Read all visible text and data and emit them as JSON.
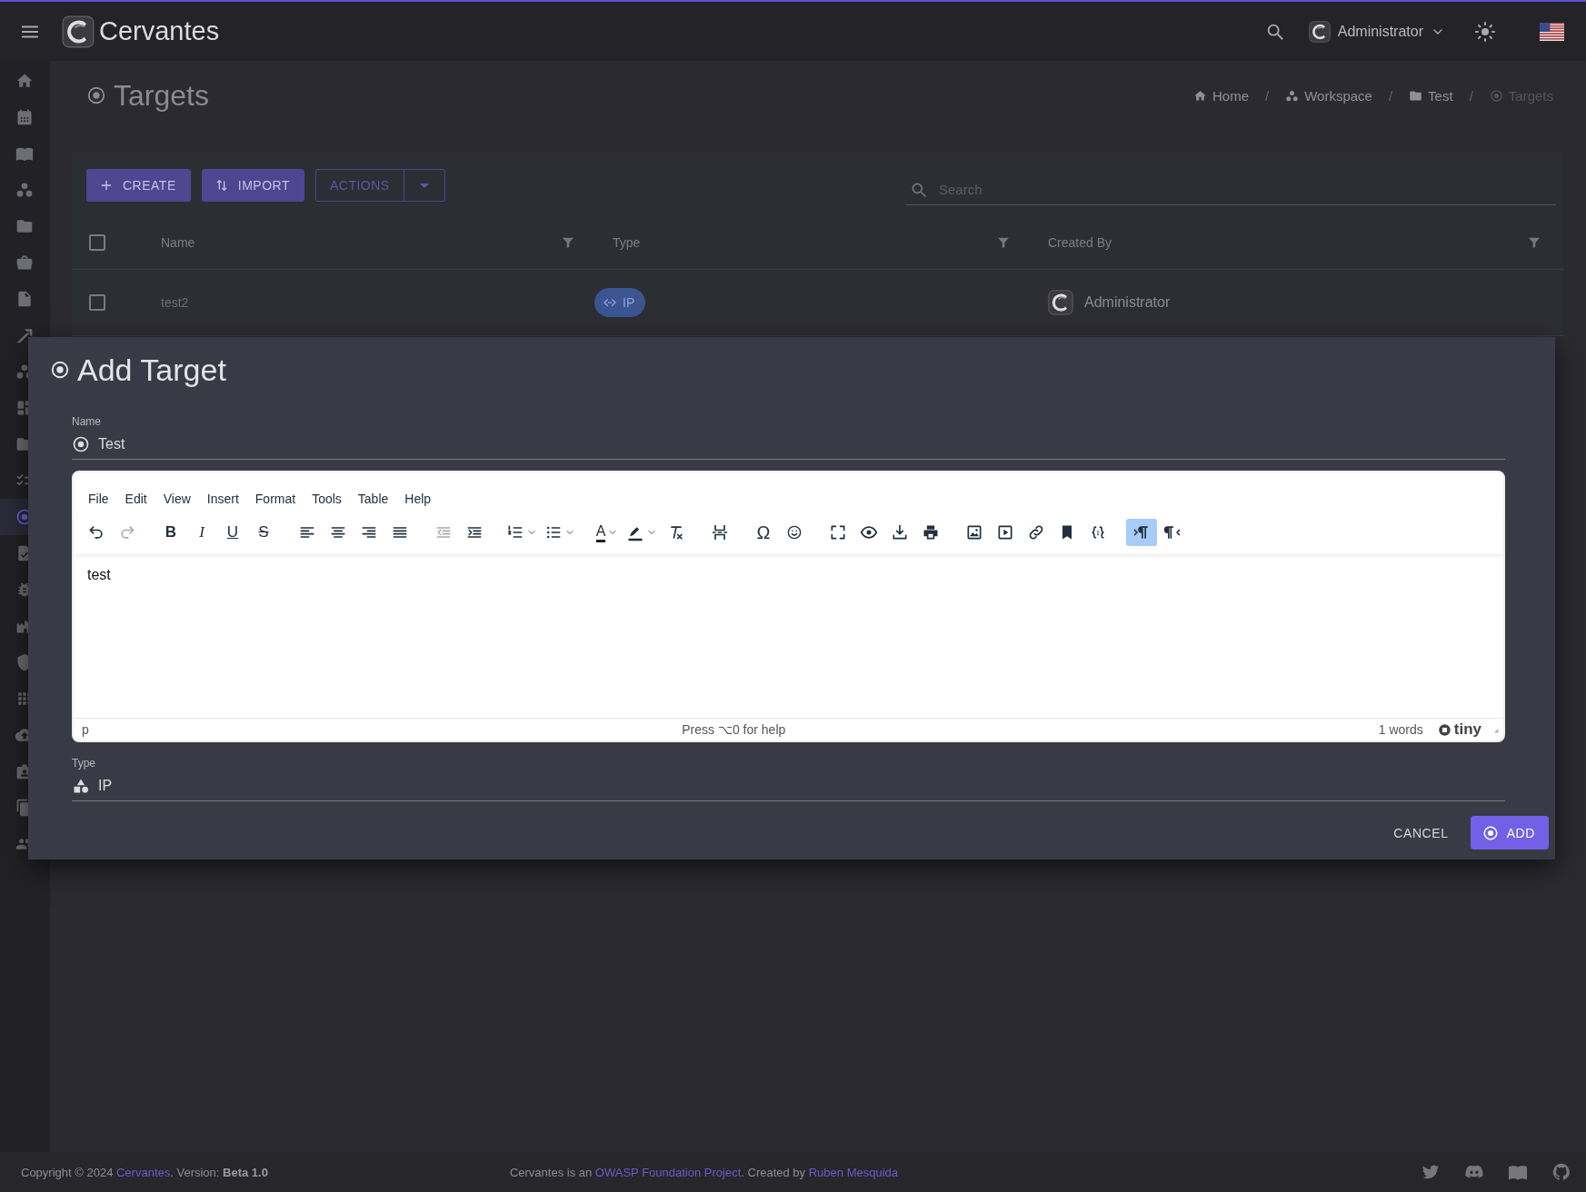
{
  "app": {
    "title": "Cervantes"
  },
  "header": {
    "user": "Administrator"
  },
  "sidebar": {
    "items": [
      {
        "selected": false
      },
      {
        "selected": false
      },
      {
        "selected": false
      },
      {
        "selected": false
      },
      {
        "selected": false
      },
      {
        "selected": false
      },
      {
        "selected": false
      },
      {
        "selected": false
      },
      {
        "selected": false
      },
      {
        "selected": false
      },
      {
        "selected": false
      },
      {
        "selected": false
      },
      {
        "selected": true
      },
      {
        "selected": false
      },
      {
        "selected": false
      },
      {
        "selected": false
      },
      {
        "selected": false
      },
      {
        "selected": false
      },
      {
        "selected": false
      },
      {
        "selected": false
      },
      {
        "selected": false
      },
      {
        "selected": false
      }
    ]
  },
  "page": {
    "title": "Targets",
    "breadcrumbs": [
      {
        "label": "Home",
        "current": false
      },
      {
        "separator": "/",
        "label": "Workspace",
        "current": false
      },
      {
        "separator": "/",
        "label": "Test",
        "current": false
      },
      {
        "separator": "/",
        "label": "Targets",
        "current": true
      }
    ]
  },
  "toolbar": {
    "create": "CREATE",
    "import": "IMPORT",
    "actions": "ACTIONS",
    "search": {
      "placeholder": "Search"
    }
  },
  "table": {
    "header_checked": false,
    "columns": [
      "Name",
      "Type",
      "Created By"
    ],
    "rows": [
      {
        "checked": false,
        "name": "test2",
        "type": "IP",
        "created_by": "Administrator"
      }
    ]
  },
  "dialog": {
    "title": "Add Target",
    "name_field": {
      "label": "Name",
      "value": "Test"
    },
    "editor": {
      "menu": [
        "File",
        "Edit",
        "View",
        "Insert",
        "Format",
        "Tools",
        "Table",
        "Help"
      ],
      "toolbar": [
        [
          {
            "kind": "icon",
            "split": false,
            "active": false,
            "disabled": false
          },
          {
            "kind": "icon",
            "split": false,
            "active": false,
            "disabled": true
          }
        ],
        [
          {
            "kind": "glyph",
            "glyph": "B",
            "split": false,
            "active": false,
            "disabled": false
          },
          {
            "kind": "glyph",
            "glyph": "I",
            "split": false,
            "active": false,
            "disabled": false
          },
          {
            "kind": "glyph",
            "glyph": "U",
            "split": false,
            "active": false,
            "disabled": false
          },
          {
            "kind": "glyph",
            "glyph": "S",
            "split": false,
            "active": false,
            "disabled": false
          }
        ],
        [
          {
            "kind": "icon",
            "split": false,
            "active": false,
            "disabled": false
          },
          {
            "kind": "icon",
            "split": false,
            "active": false,
            "disabled": false
          },
          {
            "kind": "icon",
            "split": false,
            "active": false,
            "disabled": false
          },
          {
            "kind": "icon",
            "split": false,
            "active": false,
            "disabled": false
          }
        ],
        [
          {
            "kind": "icon",
            "split": false,
            "active": false,
            "disabled": true
          },
          {
            "kind": "icon",
            "split": false,
            "active": false,
            "disabled": false
          }
        ],
        [
          {
            "kind": "icon",
            "split": true,
            "active": false,
            "disabled": false
          },
          {
            "kind": "icon",
            "split": true,
            "active": false,
            "disabled": false
          }
        ],
        [
          {
            "kind": "glyph",
            "glyph": "A",
            "split": true,
            "active": false,
            "disabled": false
          },
          {
            "kind": "icon",
            "split": true,
            "active": false,
            "disabled": false
          },
          {
            "kind": "icon",
            "split": false,
            "active": false,
            "disabled": false
          }
        ],
        [
          {
            "kind": "icon",
            "split": false,
            "active": false,
            "disabled": false
          }
        ],
        [
          {
            "kind": "glyph",
            "glyph": "Ω",
            "split": false,
            "active": false,
            "disabled": false
          },
          {
            "kind": "icon",
            "split": false,
            "active": false,
            "disabled": false
          }
        ],
        [
          {
            "kind": "icon",
            "split": false,
            "active": false,
            "disabled": false
          },
          {
            "kind": "icon",
            "split": false,
            "active": false,
            "disabled": false
          },
          {
            "kind": "icon",
            "split": false,
            "active": false,
            "disabled": false
          },
          {
            "kind": "icon",
            "split": false,
            "active": false,
            "disabled": false
          }
        ],
        [
          {
            "kind": "icon",
            "split": false,
            "active": false,
            "disabled": false
          },
          {
            "kind": "icon",
            "split": false,
            "active": false,
            "disabled": false
          },
          {
            "kind": "icon",
            "split": false,
            "active": false,
            "disabled": false
          },
          {
            "kind": "icon",
            "split": false,
            "active": false,
            "disabled": false
          },
          {
            "kind": "icon",
            "split": false,
            "active": false,
            "disabled": false
          }
        ],
        [
          {
            "kind": "icon",
            "split": false,
            "active": true,
            "disabled": false
          },
          {
            "kind": "icon",
            "split": false,
            "active": false,
            "disabled": false
          }
        ]
      ],
      "content": "test",
      "path": "p",
      "help": "Press ⌥0 for help",
      "word_count": "1 words",
      "brand": "tiny"
    },
    "type_field": {
      "label": "Type",
      "value": "IP"
    },
    "cancel": "CANCEL",
    "add": "ADD"
  },
  "footer": {
    "copyright": "Copyright © 2024 ",
    "copyright_link": "Cervantes",
    "version": ". Version: **Beta 1.0**",
    "about": "Cervantes is an ",
    "about_link": "OWASP Foundation Project",
    "created": ". Created by ",
    "author_link": "Ruben Mesquida"
  }
}
